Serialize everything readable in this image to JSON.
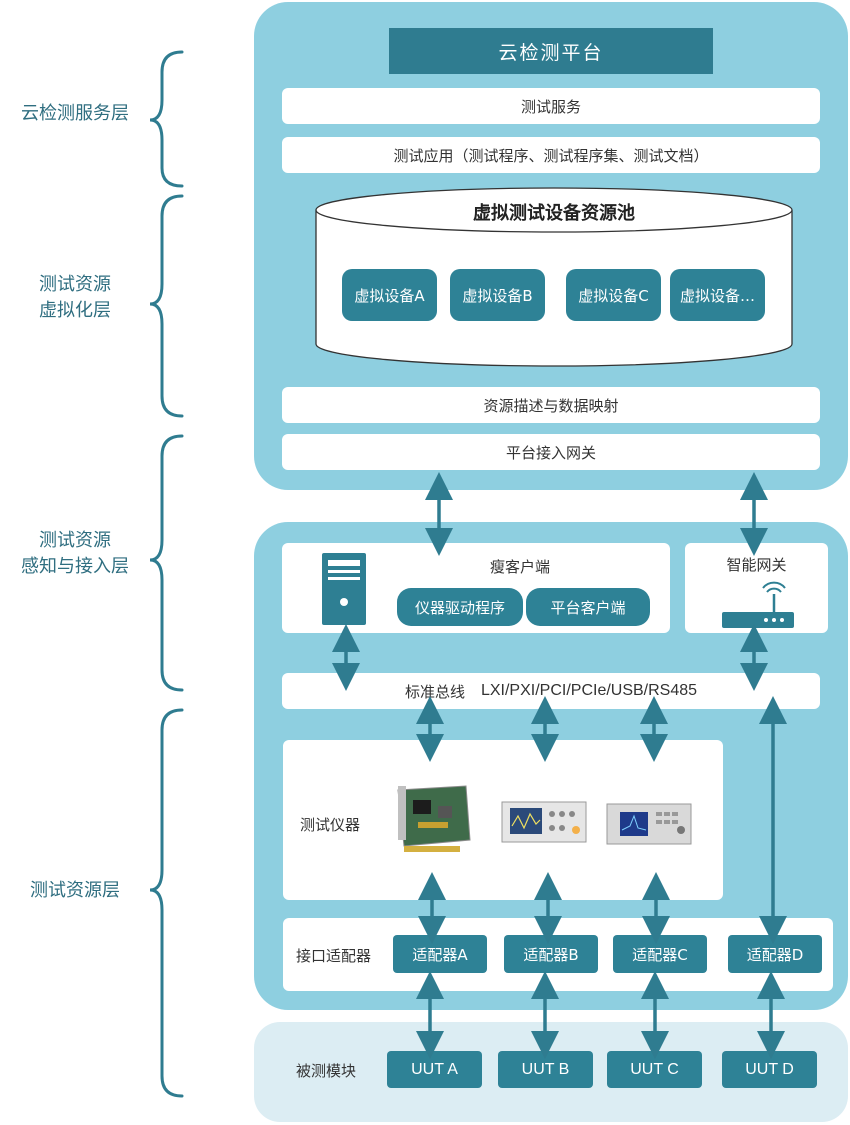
{
  "layers": {
    "cloud_service": "云检测服务层",
    "virtualization_line1": "测试资源",
    "virtualization_line2": "虚拟化层",
    "sensing_line1": "测试资源",
    "sensing_line2": "感知与接入层",
    "resource": "测试资源层"
  },
  "platform": {
    "title": "云检测平台",
    "test_service": "测试服务",
    "test_application": "测试应用（测试程序、测试程序集、测试文档）",
    "pool_title": "虚拟测试设备资源池",
    "virtual_devices": [
      "虚拟设备A",
      "虚拟设备B",
      "虚拟设备C",
      "虚拟设备…"
    ],
    "resource_mapping": "资源描述与数据映射",
    "gateway": "平台接入网关"
  },
  "access": {
    "thin_client": "瘦客户端",
    "driver": "仪器驱动程序",
    "platform_client": "平台客户端",
    "smart_gateway": "智能网关",
    "bus_label": "标准总线",
    "bus_types": "LXI/PXI/PCI/PCIe/USB/RS485"
  },
  "resources": {
    "instruments_label": "测试仪器",
    "adapter_label": "接口适配器",
    "adapters": [
      "适配器A",
      "适配器B",
      "适配器C",
      "适配器D"
    ],
    "modules_label": "被测模块",
    "uuts": [
      "UUT A",
      "UUT B",
      "UUT C",
      "UUT D"
    ]
  },
  "colors": {
    "panel": "#8ecfe0",
    "dark_teal": "#2e8296",
    "arrow": "#2f7c90",
    "bracket": "#2f7c90",
    "light_panel": "#dcedf3"
  },
  "icons": [
    "server-tower-icon",
    "router-icon",
    "pxi-card-icon",
    "oscilloscope-icon",
    "signal-analyzer-icon"
  ]
}
